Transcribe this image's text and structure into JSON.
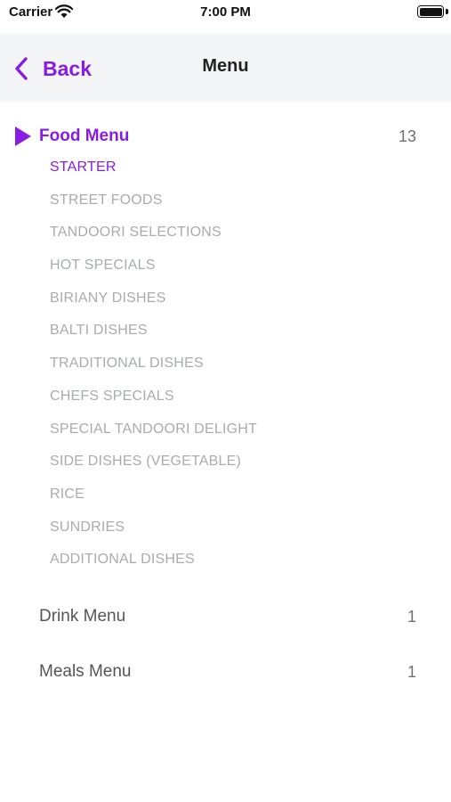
{
  "status_bar": {
    "carrier": "Carrier",
    "time": "7:00 PM"
  },
  "nav": {
    "back_label": "Back",
    "title": "Menu"
  },
  "colors": {
    "accent": "#8a1be2",
    "inactive_text": "#a8acb0",
    "nav_background": "#f4f5f6"
  },
  "menus": [
    {
      "title": "Food Menu",
      "count": "13",
      "expanded": true,
      "items": [
        "STARTER",
        "STREET FOODS",
        "TANDOORI SELECTIONS",
        "HOT SPECIALS",
        "BIRIANY DISHES",
        "BALTI DISHES",
        "TRADITIONAL DISHES",
        "CHEFS SPECIALS",
        "SPECIAL TANDOORI DELIGHT",
        "SIDE DISHES (VEGETABLE)",
        "RICE",
        "SUNDRIES",
        "ADDITIONAL DISHES"
      ],
      "selected_item": "STARTER"
    },
    {
      "title": "Drink Menu",
      "count": "1",
      "expanded": false
    },
    {
      "title": "Meals Menu",
      "count": "1",
      "expanded": false
    }
  ]
}
